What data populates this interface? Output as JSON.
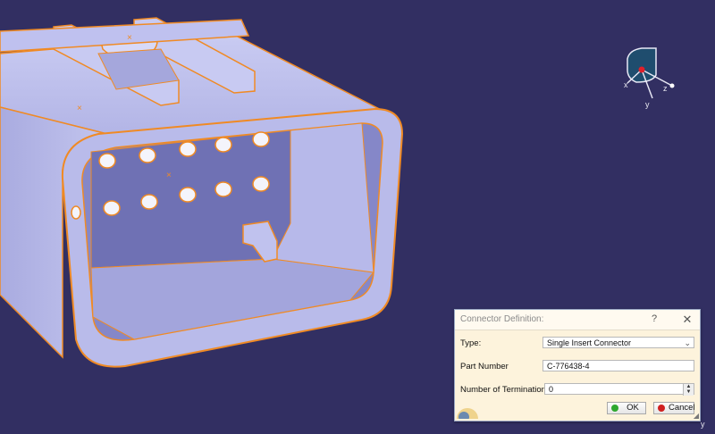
{
  "viewport": {
    "background": "#322f62",
    "model_fill": "#b5b7e6",
    "edge_color": "#f08a24"
  },
  "compass": {
    "axis_x": "x",
    "axis_y": "y",
    "axis_z": "z",
    "corner_axis": "y"
  },
  "dialog": {
    "title": "Connector Definition:",
    "help": "?",
    "close": "✕",
    "type_label": "Type:",
    "type_value": "Single Insert Connector",
    "part_label": "Part Number",
    "part_value": "C-776438-4",
    "term_label": "Number of Terminations:",
    "term_value": "0",
    "ok_label": "OK",
    "cancel_label": "Cancel",
    "ok_color": "#2ea82e",
    "cancel_color": "#d02020"
  }
}
